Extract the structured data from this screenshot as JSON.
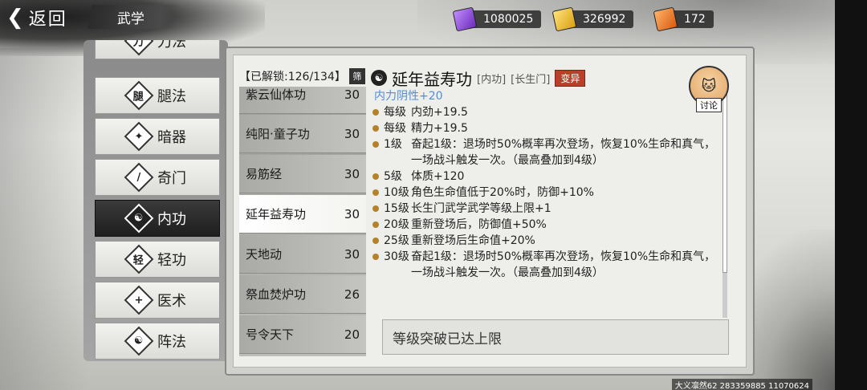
{
  "header": {
    "back_label": "返回",
    "section_title": "武学"
  },
  "currencies": [
    {
      "icon": "purple-jade-icon",
      "value": "1080025"
    },
    {
      "icon": "gold-ingot-icon",
      "value": "326992"
    },
    {
      "icon": "flame-token-icon",
      "value": "172"
    }
  ],
  "categories": [
    {
      "label": "刀法",
      "icon": "blade-icon"
    },
    {
      "label": "腿法",
      "icon": "kick-icon"
    },
    {
      "label": "暗器",
      "icon": "shuriken-icon"
    },
    {
      "label": "奇门",
      "icon": "strange-weapon-icon"
    },
    {
      "label": "内功",
      "icon": "inner-art-icon",
      "active": true
    },
    {
      "label": "轻功",
      "icon": "lightness-icon"
    },
    {
      "label": "医术",
      "icon": "medicine-icon"
    },
    {
      "label": "阵法",
      "icon": "formation-icon"
    }
  ],
  "skill_list": {
    "unlock_label": "【已解锁:126/134】",
    "filter_label": "筛",
    "items": [
      {
        "name": "紫云仙体功",
        "level": "30"
      },
      {
        "name": "纯阳·童子功",
        "level": "30"
      },
      {
        "name": "易筋经",
        "level": "30"
      },
      {
        "name": "延年益寿功",
        "level": "30",
        "active": true
      },
      {
        "name": "天地动",
        "level": "30"
      },
      {
        "name": "祭血焚炉功",
        "level": "26"
      },
      {
        "name": "号令天下",
        "level": "20"
      }
    ]
  },
  "detail": {
    "icon": "yin-yang-icon",
    "name": "延年益寿功",
    "type_tag": "[内功]",
    "sect_tag": "[长生门]",
    "mutation_label": "变异",
    "lines": [
      {
        "lv": "",
        "text": "内力阴性+20",
        "highlight": true,
        "dot": false
      },
      {
        "lv": "每级",
        "text": "内劲+19.5",
        "dot": true
      },
      {
        "lv": "每级",
        "text": "精力+19.5",
        "dot": true
      },
      {
        "lv": "1级",
        "text": "奋起1级：退场时50%概率再次登场，恢复10%生命和真气，一场战斗触发一次。（最高叠加到4级）",
        "dot": true
      },
      {
        "lv": "5级",
        "text": "体质+120",
        "dot": true
      },
      {
        "lv": "10级",
        "text": "角色生命值低于20%时，防御+10%",
        "dot": true
      },
      {
        "lv": "15级",
        "text": "长生门武学武学等级上限+1",
        "dot": true
      },
      {
        "lv": "20级",
        "text": "重新登场后，防御值+50%",
        "dot": true
      },
      {
        "lv": "25级",
        "text": "重新登场后生命值+20%",
        "dot": true
      },
      {
        "lv": "30级",
        "text": "奋起1级：退场时50%概率再次登场，恢复10%生命和真气，一场战斗触发一次。（最高叠加到4级）",
        "dot": true
      }
    ],
    "status_text": "等级突破已达上限",
    "discuss_label": "讨论"
  },
  "footer": {
    "server_info": "大义凛然62 283359885  11070624"
  }
}
